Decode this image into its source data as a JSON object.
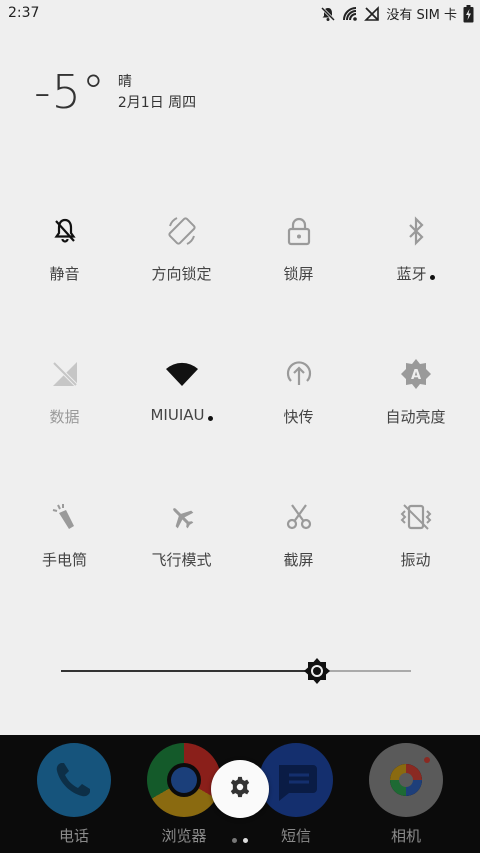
{
  "status_bar": {
    "time": "2:37",
    "carrier": "没有 SIM 卡",
    "icons": [
      "bell-off-icon",
      "wifi-calling-icon",
      "no-signal-icon",
      "battery-charging-icon"
    ]
  },
  "weather": {
    "temperature": "-5°",
    "condition": "晴",
    "date": "2月1日 周四"
  },
  "quick_settings": {
    "tiles": [
      {
        "label": "静音",
        "icon": "silent-icon",
        "active": true
      },
      {
        "label": "方向锁定",
        "icon": "rotation-lock-icon",
        "active": false
      },
      {
        "label": "锁屏",
        "icon": "lock-icon",
        "active": false
      },
      {
        "label": "蓝牙",
        "icon": "bluetooth-icon",
        "active": false,
        "has_dot": true
      },
      {
        "label": "数据",
        "icon": "mobile-data-icon",
        "active": false,
        "disabled": true
      },
      {
        "label": "MIUIAU",
        "icon": "wifi-icon",
        "active": true,
        "has_dot": true
      },
      {
        "label": "快传",
        "icon": "quick-transfer-icon",
        "active": false
      },
      {
        "label": "自动亮度",
        "icon": "auto-brightness-icon",
        "active": false
      },
      {
        "label": "手电筒",
        "icon": "flashlight-icon",
        "active": false
      },
      {
        "label": "飞行模式",
        "icon": "airplane-icon",
        "active": false
      },
      {
        "label": "截屏",
        "icon": "scissors-icon",
        "active": false
      },
      {
        "label": "振动",
        "icon": "vibrate-icon",
        "active": false
      }
    ]
  },
  "brightness": {
    "level": 0.73,
    "icon": "brightness-icon"
  },
  "dock": {
    "apps": [
      {
        "label": "电话",
        "icon": "phone-icon",
        "color": "#1f73a8"
      },
      {
        "label": "浏览器",
        "icon": "browser-icon",
        "color": "#c7362e"
      },
      {
        "label": "短信",
        "icon": "messages-icon",
        "color": "#1e4bb0"
      },
      {
        "label": "相机",
        "icon": "camera-icon",
        "color": "#e8e8e8"
      }
    ],
    "settings_icon": "gear-icon",
    "pages": 2,
    "current_page": 2
  }
}
